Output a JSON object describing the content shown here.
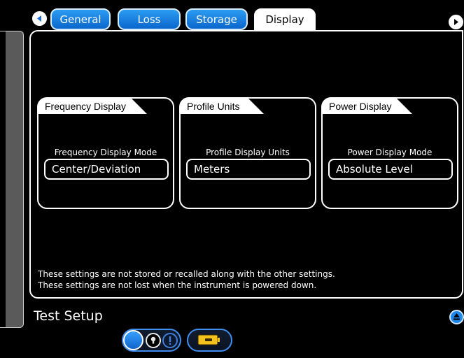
{
  "tabs": [
    {
      "label": "General",
      "active": false
    },
    {
      "label": "Loss",
      "active": false
    },
    {
      "label": "Storage",
      "active": false
    },
    {
      "label": "Display",
      "active": true
    }
  ],
  "groups": {
    "frequency": {
      "title": "Frequency Display",
      "field_label": "Frequency Display Mode",
      "value": "Center/Deviation"
    },
    "profile": {
      "title": "Profile Units",
      "field_label": "Profile Display Units",
      "value": "Meters"
    },
    "power": {
      "title": "Power Display",
      "field_label": "Power Display Mode",
      "value": "Absolute Level"
    }
  },
  "notes": {
    "line1": "These settings are not stored or recalled along with the other settings.",
    "line2": "These settings are not lost when the instrument is powered down."
  },
  "footer": {
    "title": "Test Setup"
  },
  "icons": {
    "prev": "chevron-left-icon",
    "next": "chevron-right-icon",
    "collapse": "chevron-up-icon",
    "status_dot": "status-dot-icon",
    "lock": "lock-icon",
    "alert": "alert-icon",
    "battery": "battery-icon"
  },
  "colors": {
    "accent_blue": "#1a7fe0",
    "background": "#000000",
    "battery_yellow": "#f4c21a"
  }
}
